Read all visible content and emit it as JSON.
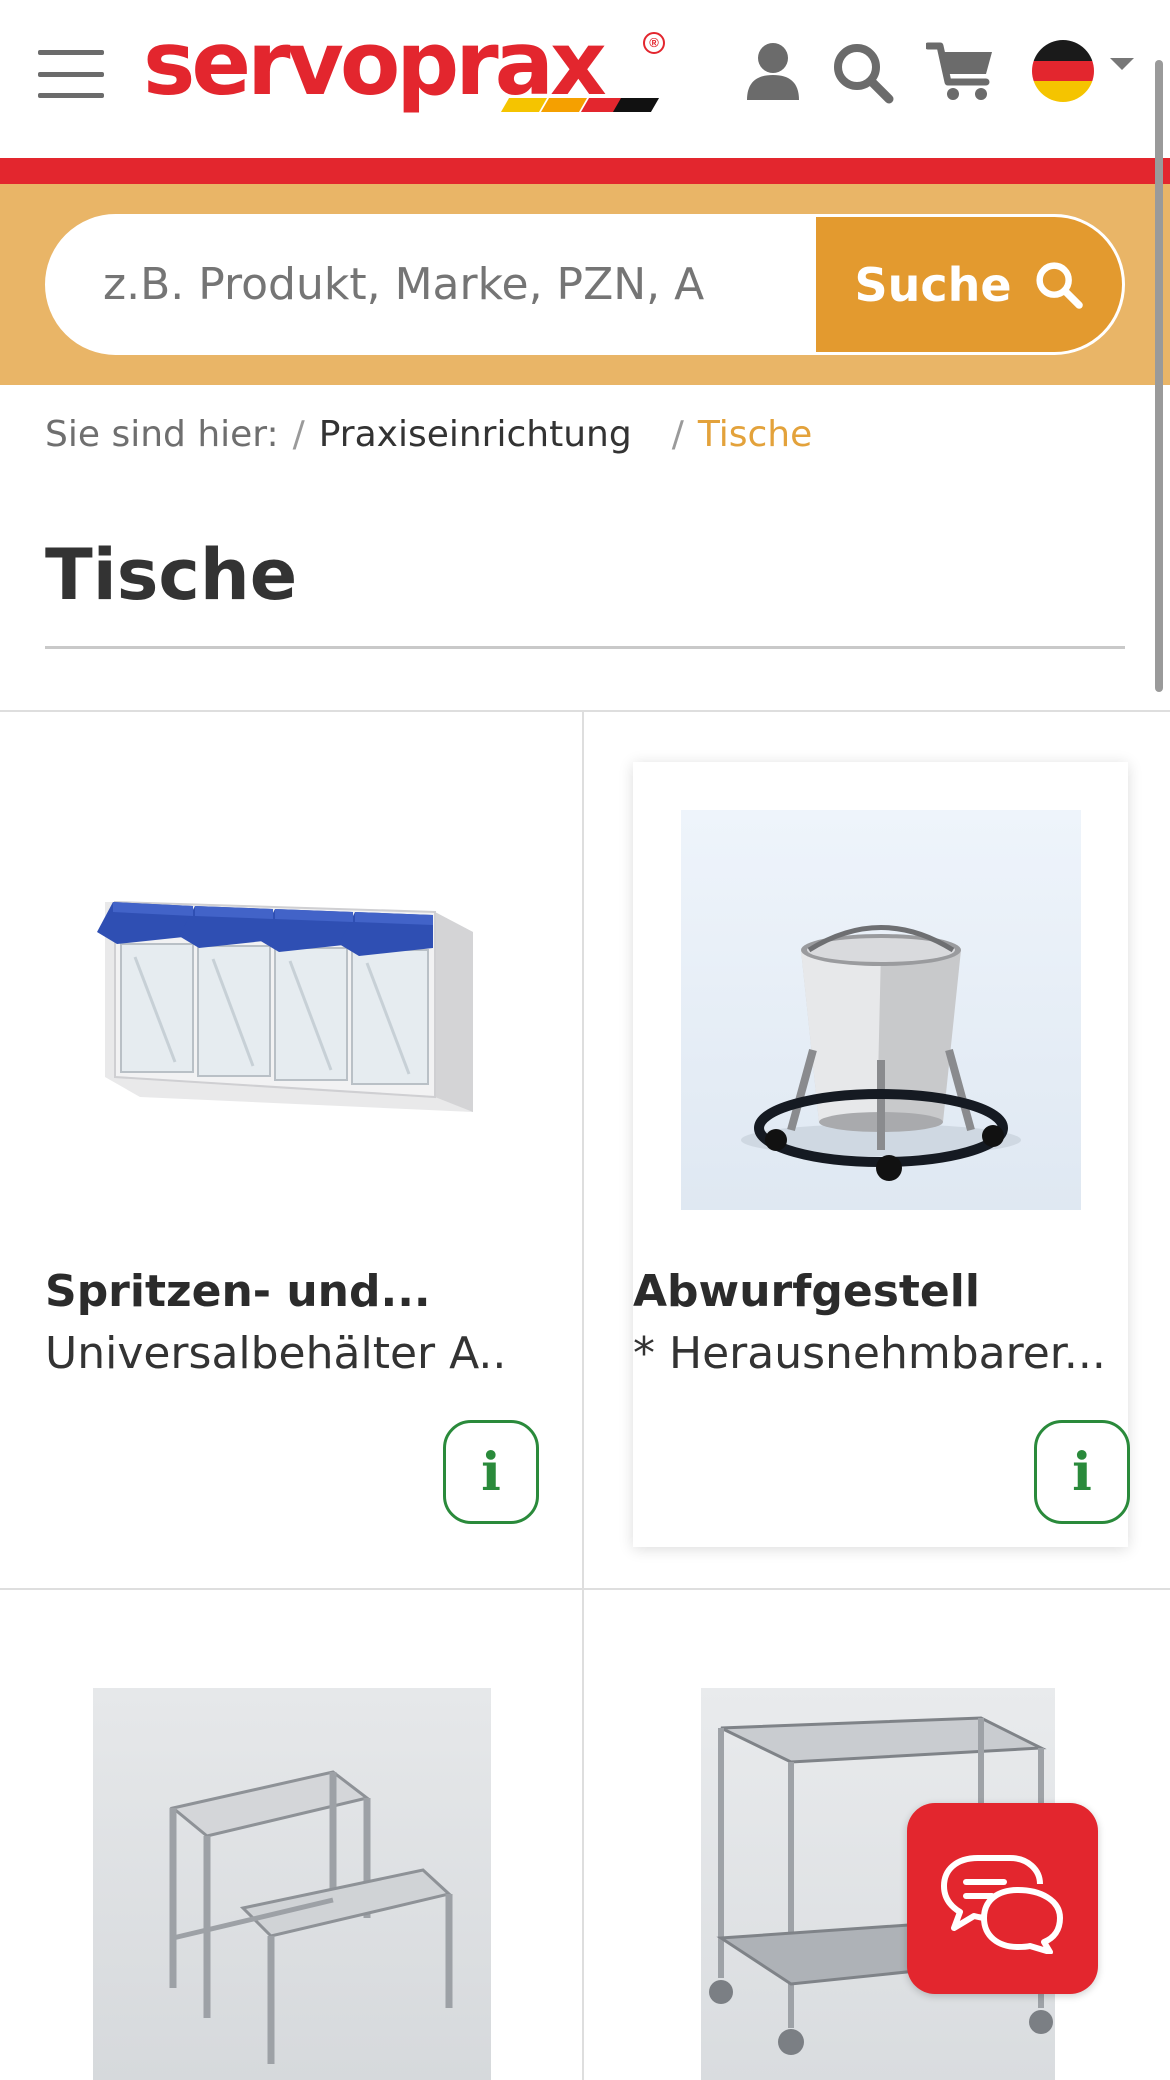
{
  "header": {
    "logo_text": "servoprax",
    "logo_reg": "®",
    "menu_icon": "menu-icon",
    "account_icon": "user-icon",
    "search_icon": "search-icon",
    "cart_icon": "cart-icon",
    "language": "de"
  },
  "colors": {
    "brand_red": "#e3262e",
    "search_band": "#e9b567",
    "search_button": "#e39a2f",
    "breadcrumb_current": "#e3a23b",
    "info_green": "#2a8a3b"
  },
  "search": {
    "placeholder": "z.B. Produkt, Marke, PZN, A",
    "button_label": "Suche"
  },
  "breadcrumb": {
    "prefix": "Sie sind hier:",
    "separator": "/",
    "items": [
      {
        "label": "Praxiseinrichtung"
      },
      {
        "label": "Tische"
      }
    ]
  },
  "page": {
    "title": "Tische"
  },
  "products": [
    {
      "name": "Spritzen- und...",
      "description": "Universalbehälter A..",
      "info_label": "i"
    },
    {
      "name": "Abwurfgestell",
      "description": "* Herausnehmbarer...",
      "info_label": "i"
    },
    {
      "name": "",
      "description": ""
    },
    {
      "name": "",
      "description": ""
    }
  ],
  "chat": {
    "icon": "chat-bubbles-icon"
  }
}
